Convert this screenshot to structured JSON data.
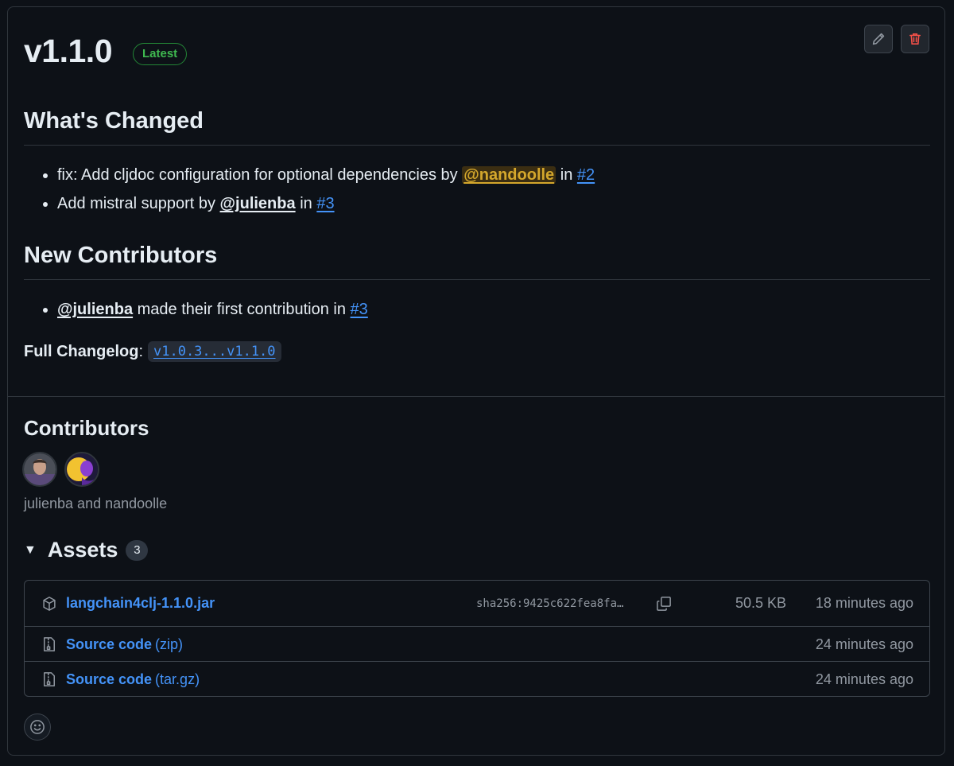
{
  "release": {
    "title": "v1.1.0",
    "badge": "Latest"
  },
  "actions": {
    "edit_icon": "pencil-icon",
    "delete_icon": "trash-icon"
  },
  "whats_changed": {
    "heading": "What's Changed",
    "items": [
      {
        "text": "fix: Add cljdoc configuration for optional dependencies by",
        "author": "@nandoolle",
        "in": "in",
        "pr": "#2"
      },
      {
        "text": "Add mistral support by",
        "author": "@julienba",
        "in": "in",
        "pr": "#3"
      }
    ]
  },
  "new_contributors": {
    "heading": "New Contributors",
    "items": [
      {
        "author": "@julienba",
        "text": "made their first contribution in",
        "pr": "#3"
      }
    ]
  },
  "changelog": {
    "label": "Full Changelog",
    "sep": ":",
    "compare": "v1.0.3...v1.1.0"
  },
  "contributors": {
    "heading": "Contributors",
    "names": "julienba and nandoolle"
  },
  "assets": {
    "heading": "Assets",
    "count": "3",
    "rows": [
      {
        "name": "langchain4clj-1.1.0.jar",
        "ext": "",
        "sha": "sha256:9425c622fea8fa…",
        "size": "50.5 KB",
        "time": "18 minutes ago"
      },
      {
        "name": "Source code",
        "ext": "(zip)",
        "time": "24 minutes ago"
      },
      {
        "name": "Source code",
        "ext": "(tar.gz)",
        "time": "24 minutes ago"
      }
    ]
  },
  "colors": {
    "background": "#0d1117",
    "link": "#4493f8",
    "latest_badge": "#3fb950",
    "delete": "#f85149",
    "mention_highlight": "#d4a72c"
  }
}
